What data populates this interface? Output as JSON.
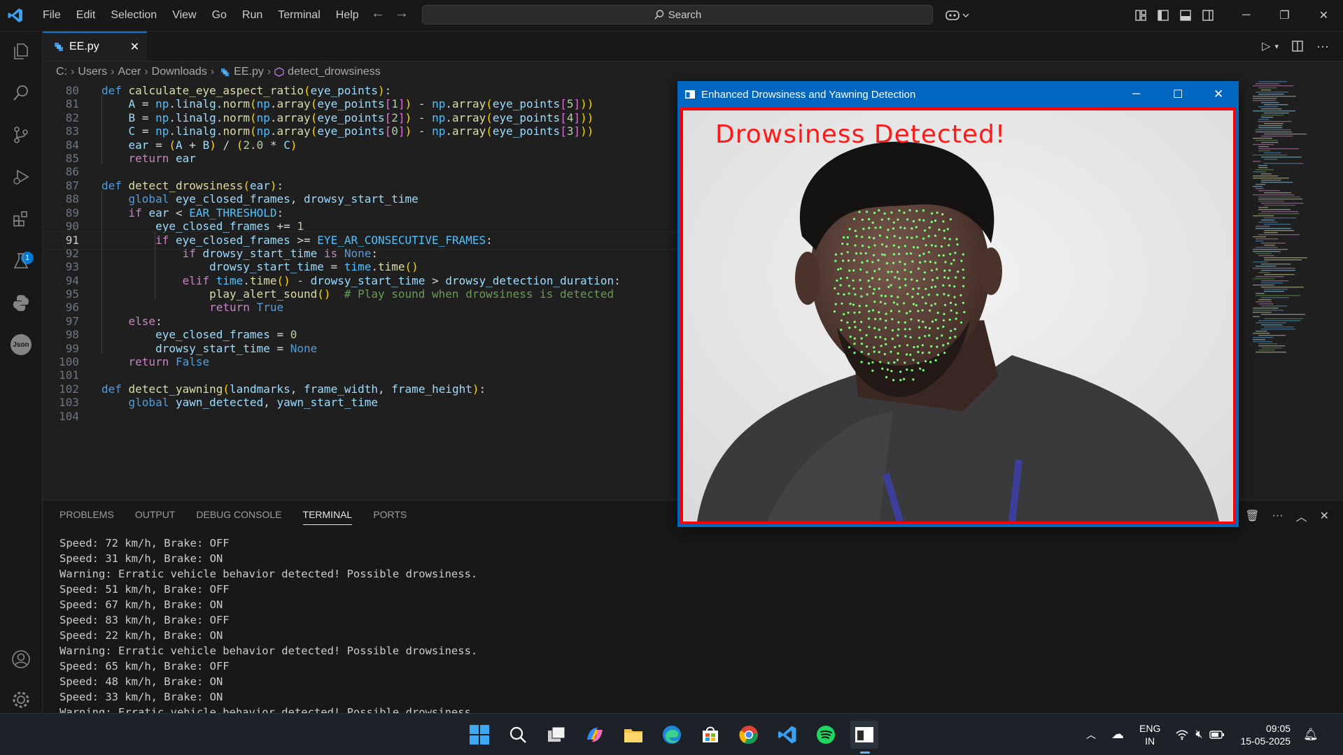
{
  "menu": [
    "File",
    "Edit",
    "Selection",
    "View",
    "Go",
    "Run",
    "Terminal",
    "Help"
  ],
  "search": {
    "label": "Search"
  },
  "tab": {
    "filename": "EE.py"
  },
  "breadcrumb": [
    "C:",
    "Users",
    "Acer",
    "Downloads",
    "EE.py",
    "detect_drowsiness"
  ],
  "activity_badge": "1",
  "code": {
    "current_line": 91,
    "lines": [
      {
        "n": "80",
        "text": "def calculate_eye_aspect_ratio(eye_points):"
      },
      {
        "n": "81",
        "text": "    A = np.linalg.norm(np.array(eye_points[1]) - np.array(eye_points[5]))"
      },
      {
        "n": "82",
        "text": "    B = np.linalg.norm(np.array(eye_points[2]) - np.array(eye_points[4]))"
      },
      {
        "n": "83",
        "text": "    C = np.linalg.norm(np.array(eye_points[0]) - np.array(eye_points[3]))"
      },
      {
        "n": "84",
        "text": "    ear = (A + B) / (2.0 * C)"
      },
      {
        "n": "85",
        "text": "    return ear"
      },
      {
        "n": "86",
        "text": ""
      },
      {
        "n": "87",
        "text": "def detect_drowsiness(ear):"
      },
      {
        "n": "88",
        "text": "    global eye_closed_frames, drowsy_start_time"
      },
      {
        "n": "89",
        "text": "    if ear < EAR_THRESHOLD:"
      },
      {
        "n": "90",
        "text": "        eye_closed_frames += 1"
      },
      {
        "n": "91",
        "text": "        if eye_closed_frames >= EYE_AR_CONSECUTIVE_FRAMES:"
      },
      {
        "n": "92",
        "text": "            if drowsy_start_time is None:"
      },
      {
        "n": "93",
        "text": "                drowsy_start_time = time.time()"
      },
      {
        "n": "94",
        "text": "            elif time.time() - drowsy_start_time > drowsy_detection_duration:"
      },
      {
        "n": "95",
        "text": "                play_alert_sound()  # Play sound when drowsiness is detected"
      },
      {
        "n": "96",
        "text": "                return True"
      },
      {
        "n": "97",
        "text": "    else:"
      },
      {
        "n": "98",
        "text": "        eye_closed_frames = 0"
      },
      {
        "n": "99",
        "text": "        drowsy_start_time = None"
      },
      {
        "n": "100",
        "text": "    return False"
      },
      {
        "n": "101",
        "text": ""
      },
      {
        "n": "102",
        "text": "def detect_yawning(landmarks, frame_width, frame_height):"
      },
      {
        "n": "103",
        "text": "    global yawn_detected, yawn_start_time"
      },
      {
        "n": "104",
        "text": ""
      }
    ]
  },
  "panel": {
    "tabs": [
      "PROBLEMS",
      "OUTPUT",
      "DEBUG CONSOLE",
      "TERMINAL",
      "PORTS"
    ],
    "active_tab": "TERMINAL",
    "terminal_lines": [
      "Speed: 72 km/h, Brake: OFF",
      "Speed: 31 km/h, Brake: ON",
      "Warning: Erratic vehicle behavior detected! Possible drowsiness.",
      "Speed: 51 km/h, Brake: OFF",
      "Speed: 67 km/h, Brake: ON",
      "Speed: 83 km/h, Brake: OFF",
      "Speed: 22 km/h, Brake: ON",
      "Warning: Erratic vehicle behavior detected! Possible drowsiness.",
      "Speed: 65 km/h, Brake: OFF",
      "Speed: 48 km/h, Brake: ON",
      "Speed: 33 km/h, Brake: ON",
      "Warning: Erratic vehicle behavior detected! Possible drowsiness."
    ]
  },
  "cv_window": {
    "title": "Enhanced Drowsiness and Yawning Detection",
    "overlay_text": "Drowsiness Detected!",
    "overlay_color": "#ff1a1a",
    "landmark_color": "#7cff7c"
  },
  "tray": {
    "lang_line1": "ENG",
    "lang_line2": "IN",
    "time": "09:05",
    "date": "15-05-2025"
  },
  "colors": {
    "accent": "#0078d4",
    "titlebar": "#181818",
    "editor_bg": "#1f1f1f"
  }
}
